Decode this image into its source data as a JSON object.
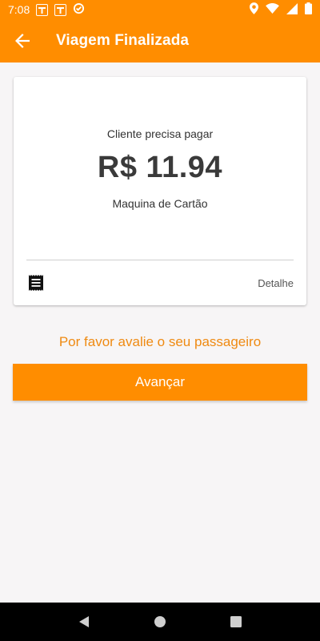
{
  "status_bar": {
    "time": "7:08",
    "icons": [
      "app-notification-icon",
      "app-notification-icon",
      "sync-icon",
      "location-icon",
      "wifi-icon",
      "signal-icon",
      "battery-icon"
    ]
  },
  "app_bar": {
    "title": "Viagem Finalizada",
    "back_icon": "arrow-back-icon",
    "color": "#ff8d00"
  },
  "payment_card": {
    "prompt": "Cliente precisa pagar",
    "amount": "R$ 11.94",
    "method": "Maquina de Cartão",
    "receipt_icon": "receipt-icon",
    "detail_label": "Detalhe"
  },
  "rating": {
    "prompt": "Por favor avalie o seu passageiro",
    "color": "#ef8a12"
  },
  "actions": {
    "advance_label": "Avançar"
  },
  "nav_bar": {
    "buttons": [
      "back-triangle-icon",
      "home-circle-icon",
      "recents-square-icon"
    ]
  }
}
